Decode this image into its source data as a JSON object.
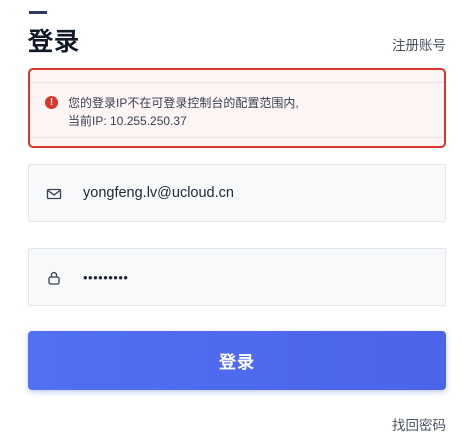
{
  "header": {
    "title": "登录",
    "register_label": "注册账号"
  },
  "alert": {
    "icon": "exclamation-icon",
    "line1": "您的登录IP不在可登录控制台的配置范围内,",
    "line2": "当前IP: 10.255.250.37",
    "border_color": "#d6382b",
    "background_color": "#fdf4f4"
  },
  "form": {
    "email": {
      "icon": "mail-icon",
      "value": "yongfeng.lv@ucloud.cn"
    },
    "password": {
      "icon": "lock-icon",
      "value": "•••••••••"
    },
    "submit_label": "登录",
    "forgot_label": "找回密码"
  },
  "colors": {
    "accent": "#4a64ea",
    "title_accent": "#2b3a67"
  }
}
